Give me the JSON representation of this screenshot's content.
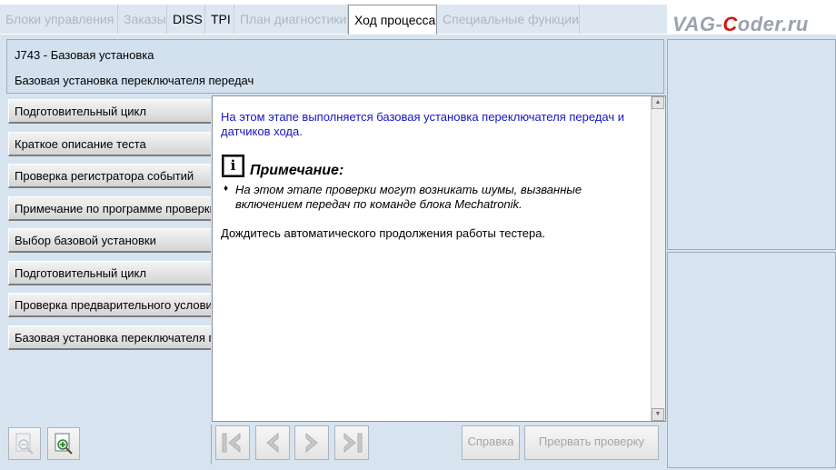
{
  "tabs": [
    {
      "label": "Блоки управления",
      "state": "disabled"
    },
    {
      "label": "Заказы",
      "state": "disabled"
    },
    {
      "label": "DISS",
      "state": "enabled"
    },
    {
      "label": "TPI",
      "state": "enabled"
    },
    {
      "label": "План диагностики",
      "state": "disabled"
    },
    {
      "label": "Ход процесса",
      "state": "active"
    },
    {
      "label": "Специальные функции",
      "state": "disabled"
    }
  ],
  "watermark": {
    "prefix": "VAG-",
    "accent": "C",
    "suffix": "oder.ru"
  },
  "header": {
    "title": "J743 - Базовая установка",
    "subtitle": "Базовая установка переключателя передач"
  },
  "steps": [
    "Подготовительный цикл",
    "Краткое описание теста",
    "Проверка регистратора событий",
    "Примечание по программе проверки",
    "Выбор базовой установки",
    "Подготовительный цикл",
    "Проверка предварительного условия",
    "Базовая установка переключателя передач"
  ],
  "content": {
    "intro": "На этом этапе выполняется базовая установка переключателя передач и датчиков хода.",
    "note_icon": "info-icon",
    "note_icon_glyph": "i",
    "note_title": "Примечание:",
    "note_bullet": "♦",
    "note_text": "На этом этапе проверки могут возникать шумы, вызванные включением передач по команде блока Mechatronik.",
    "wait_text": "Дождитесь автоматического продолжения работы тестера."
  },
  "toolbar": {
    "help_label": "Справка",
    "abort_label": "Прервать проверку"
  },
  "colors": {
    "panel_bg": "#d7e3ef",
    "intro_text": "#1515c8",
    "watermark_accent": "#d01818"
  }
}
